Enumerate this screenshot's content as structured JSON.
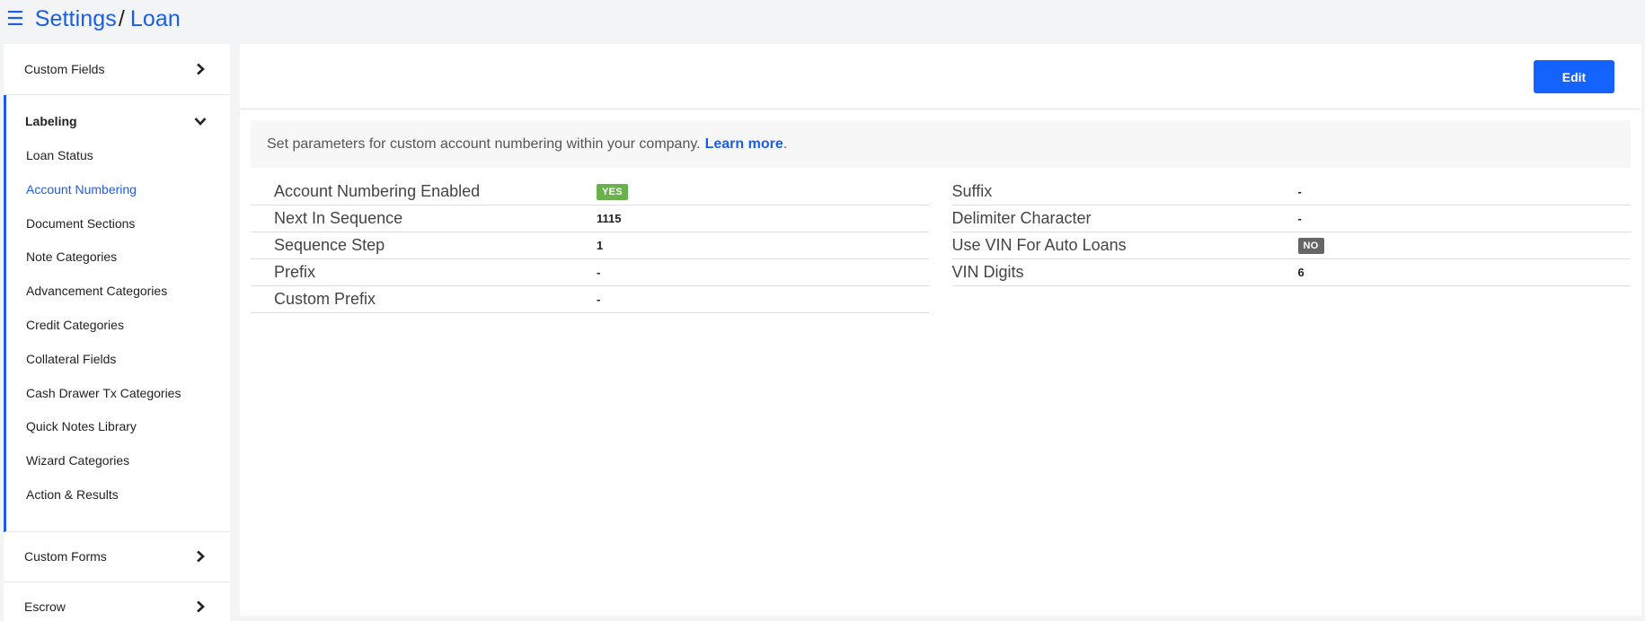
{
  "header": {
    "breadcrumb_root": "Settings",
    "breadcrumb_separator": "/",
    "breadcrumb_current": "Loan"
  },
  "sidebar": {
    "custom_fields": "Custom Fields",
    "labeling": {
      "label": "Labeling",
      "items": [
        "Loan Status",
        "Account Numbering",
        "Document Sections",
        "Note Categories",
        "Advancement Categories",
        "Credit Categories",
        "Collateral Fields",
        "Cash Drawer Tx Categories",
        "Quick Notes Library",
        "Wizard Categories",
        "Action & Results"
      ],
      "active": "Account Numbering"
    },
    "custom_forms": "Custom Forms",
    "escrow": "Escrow"
  },
  "main": {
    "edit_label": "Edit",
    "info_text": "Set parameters for custom account numbering within your company.",
    "learn_more": "Learn more",
    "info_period": ".",
    "left_fields": [
      {
        "label": "Account Numbering Enabled",
        "value": "YES",
        "badge": "yes"
      },
      {
        "label": "Next In Sequence",
        "value": "1115"
      },
      {
        "label": "Sequence Step",
        "value": "1"
      },
      {
        "label": "Prefix",
        "value": "-"
      },
      {
        "label": "Custom Prefix",
        "value": "-"
      }
    ],
    "right_fields": [
      {
        "label": "Suffix",
        "value": "-"
      },
      {
        "label": "Delimiter Character",
        "value": "-"
      },
      {
        "label": "Use VIN For Auto Loans",
        "value": "NO",
        "badge": "no"
      },
      {
        "label": "VIN Digits",
        "value": "6"
      }
    ]
  },
  "colors": {
    "accent": "#1a5ee8",
    "button": "#1463ff",
    "badge_yes": "#6ab04c",
    "badge_no": "#666666"
  },
  "icons": {
    "menu": "hamburger-icon",
    "collapsed": "chevron-right-icon",
    "expanded": "chevron-down-icon"
  }
}
